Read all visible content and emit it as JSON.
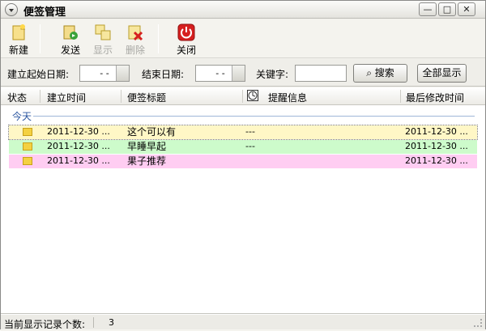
{
  "window": {
    "title": "便签管理",
    "controls": {
      "minimize": "—",
      "maximize": "□",
      "close": "✕"
    }
  },
  "toolbar": {
    "new_label": "新建",
    "send_label": "发送",
    "show_label": "显示",
    "delete_label": "删除",
    "close_label": "关闭"
  },
  "filter": {
    "start_date_label": "建立起始日期:",
    "start_date_value": "- -",
    "end_date_label": "结束日期:",
    "end_date_value": "- -",
    "keyword_label": "关键字:",
    "keyword_value": "",
    "search_label": "搜索",
    "show_all_label": "全部显示"
  },
  "table": {
    "columns": [
      "状态",
      "建立时间",
      "便签标题",
      "提醒信息",
      "最后修改时间"
    ],
    "group": "今天",
    "rows": [
      {
        "created": "2011-12-30 ...",
        "title": "这个可以有",
        "reminder": "---",
        "modified": "2011-12-30 ...",
        "color": "#fff7c6"
      },
      {
        "created": "2011-12-30 ...",
        "title": "早睡早起",
        "reminder": "---",
        "modified": "2011-12-30 ...",
        "color": "#cdfbcb"
      },
      {
        "created": "2011-12-30 ...",
        "title": "果子推荐",
        "reminder": "",
        "modified": "2011-12-30 ...",
        "color": "#ffcdf2"
      }
    ]
  },
  "status": {
    "label": "当前显示记录个数:",
    "count": "3"
  }
}
